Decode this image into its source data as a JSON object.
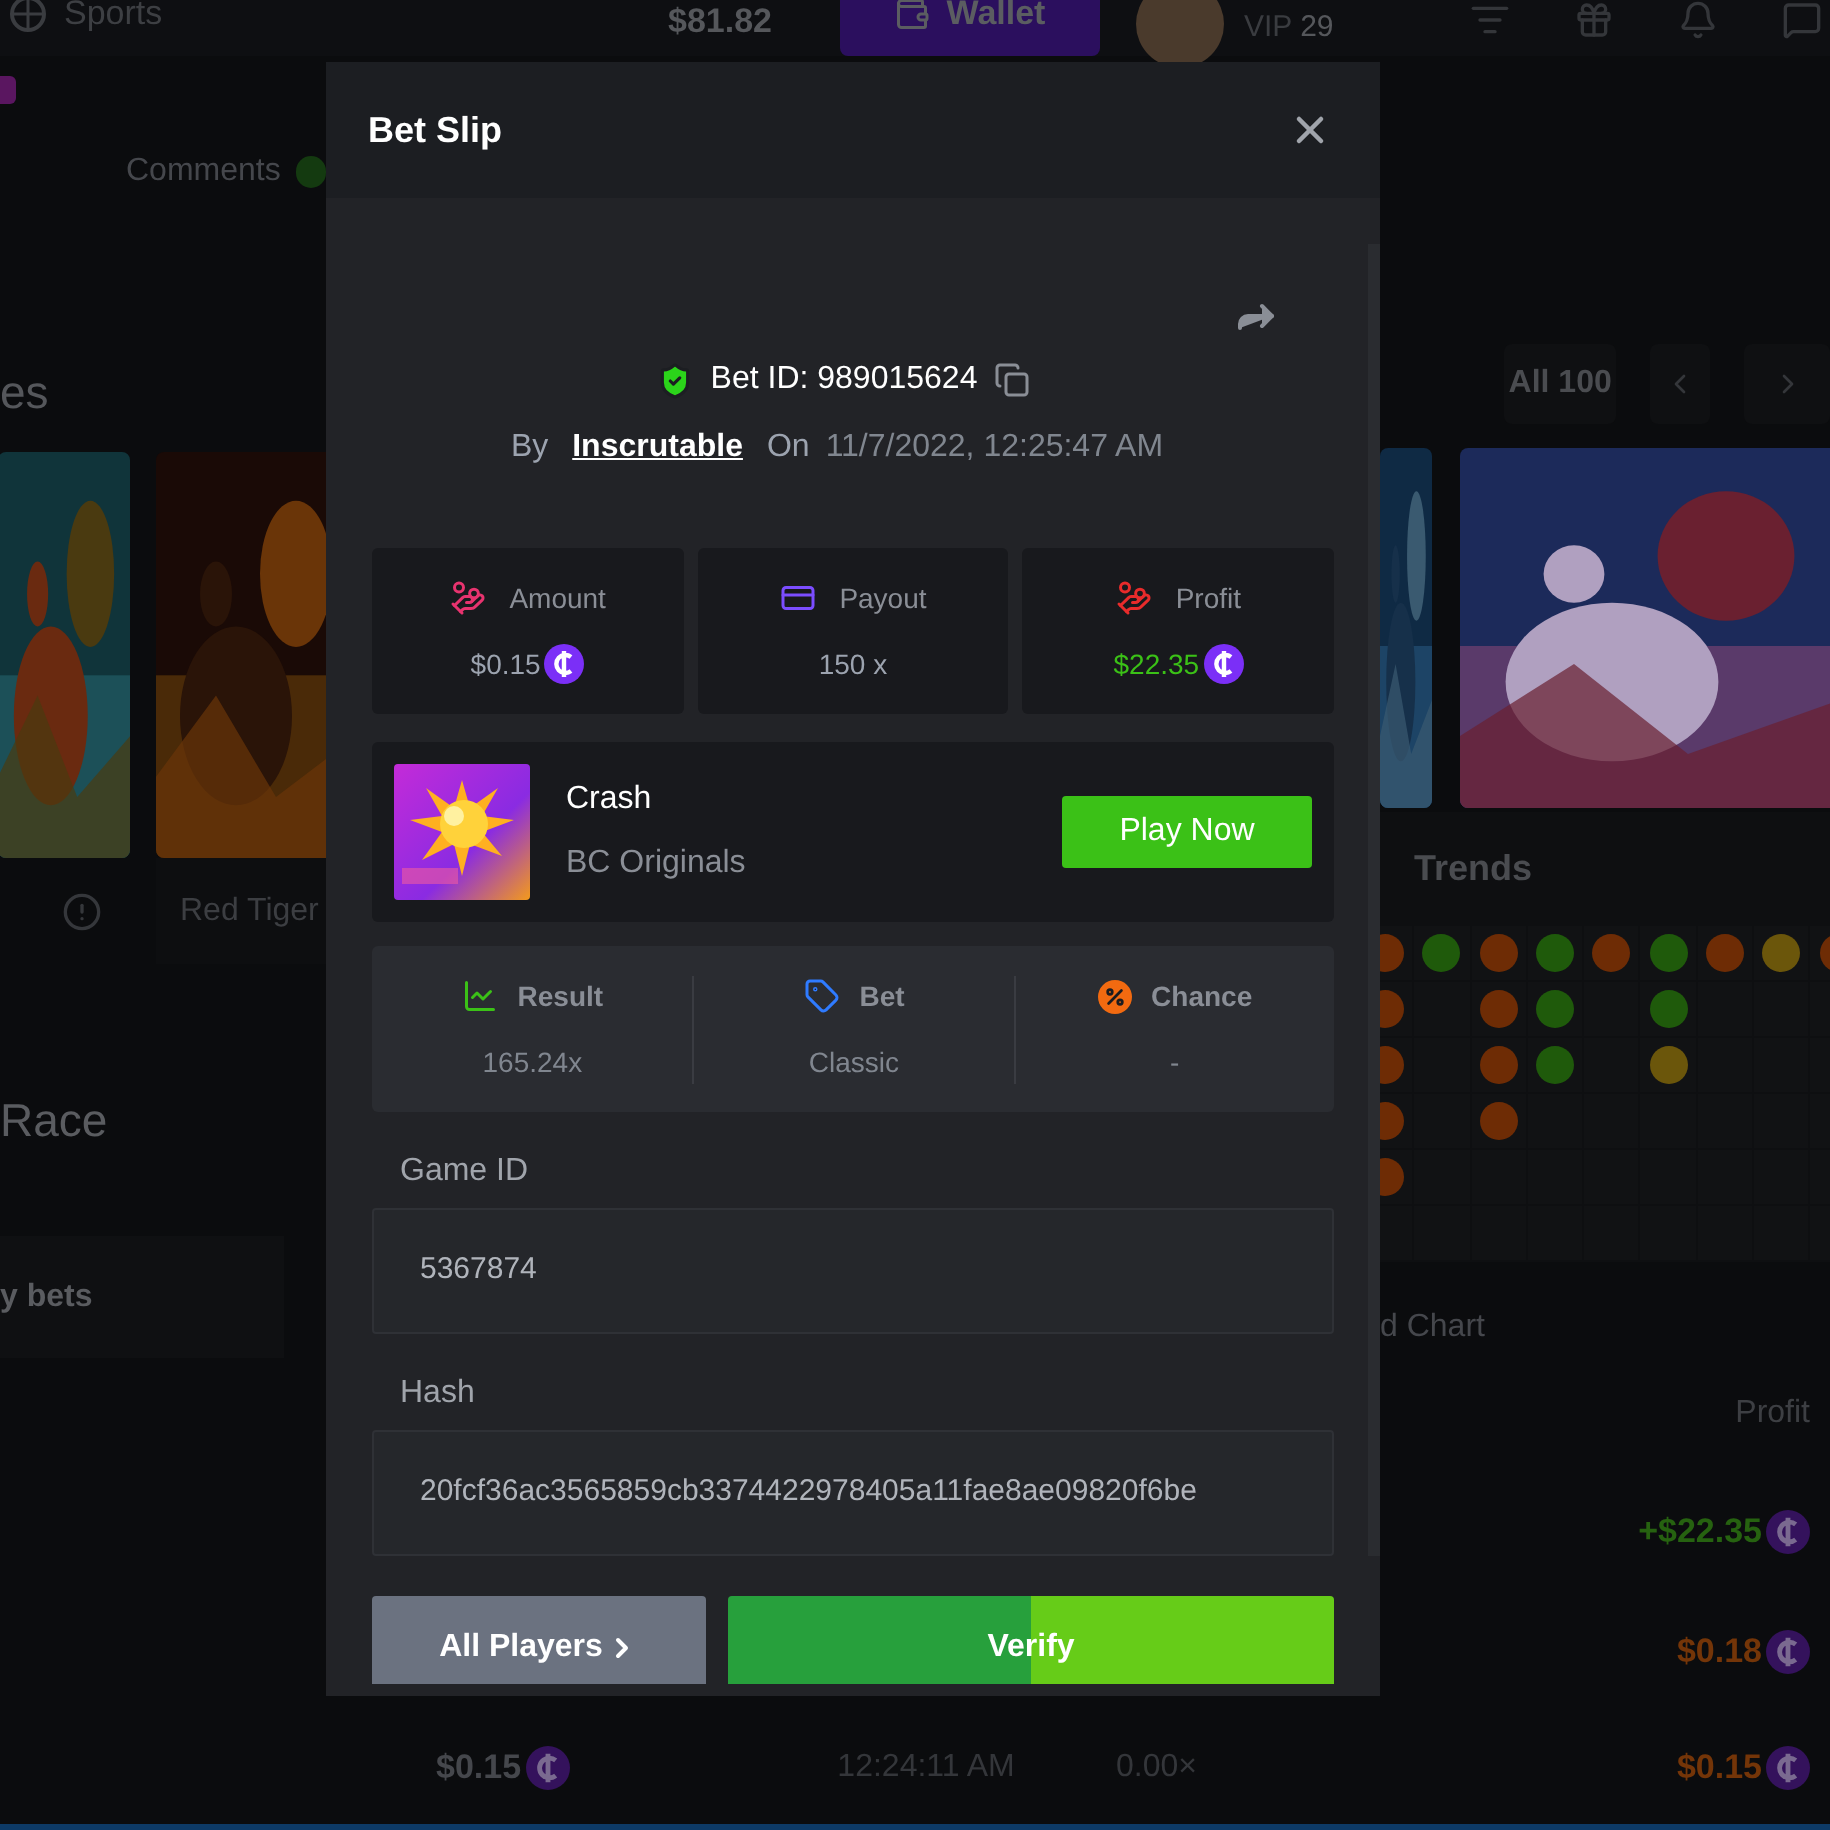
{
  "top_bar": {
    "nav_label": "Sports",
    "balance": "$81.82",
    "wallet_button": "Wallet",
    "vip_label": "VIP",
    "vip_level": "29"
  },
  "comments_tab": "Comments",
  "section_title": "es",
  "all_button": "All 100",
  "provider": "Red Tiger",
  "race_title": "Race",
  "bets_tab": "y bets",
  "trends": {
    "title": "Trends",
    "columns": [
      {
        "dots": [
          {
            "color": "#6e2c05"
          },
          {
            "color": "#6e2c05"
          },
          {
            "color": "#6e2c05"
          },
          {
            "color": "#6e2c05"
          },
          {
            "color": "#6e2c05"
          }
        ]
      },
      {
        "dots": [
          {
            "color": "#1f5a0b"
          }
        ]
      },
      {
        "dots": [
          {
            "color": "#6e2c05"
          },
          {
            "color": "#6e2c05"
          },
          {
            "color": "#6e2c05"
          },
          {
            "color": "#6e2c05"
          }
        ]
      },
      {
        "dots": [
          {
            "color": "#1f5a0b"
          },
          {
            "color": "#1f5a0b"
          },
          {
            "color": "#1f5a0b"
          }
        ]
      },
      {
        "dots": [
          {
            "color": "#6e2c05"
          }
        ]
      },
      {
        "dots": [
          {
            "color": "#1f5a0b"
          },
          {
            "color": "#1f5a0b"
          },
          {
            "color": "#6b560b"
          }
        ]
      },
      {
        "dots": [
          {
            "color": "#6e2c05"
          }
        ]
      },
      {
        "dots": [
          {
            "color": "#6b560b"
          }
        ]
      },
      {
        "dots": [
          {
            "color": "#6e2c05"
          }
        ]
      }
    ]
  },
  "chart_tab": "d Chart",
  "bets_table": {
    "profit_header": "Profit",
    "rows": [
      {
        "kind": "win",
        "profit": "+$22.35"
      },
      {
        "kind": "loss",
        "profit": "$0.18"
      },
      {
        "kind": "loss",
        "bet": "$0.15",
        "time": "12:24:11 AM",
        "payout": "0.00×",
        "profit": "$0.15"
      }
    ]
  },
  "bet_slip": {
    "title": "Bet Slip",
    "bet_id": "Bet ID: 989015624",
    "by_label": "By",
    "player": "Inscrutable",
    "on_label": "On",
    "date": "11/7/2022, 12:25:47 AM",
    "stats": [
      {
        "kind": "amount",
        "label": "Amount",
        "value": "$0.15",
        "coin": true
      },
      {
        "kind": "payout",
        "label": "Payout",
        "value": "150 x",
        "coin": false
      },
      {
        "kind": "profit",
        "label": "Profit",
        "value": "$22.35",
        "coin": true
      }
    ],
    "game": {
      "name": "Crash",
      "provider": "BC Originals",
      "play_button": "Play Now"
    },
    "details": [
      {
        "kind": "result",
        "label": "Result",
        "value": "165.24x"
      },
      {
        "kind": "bet",
        "label": "Bet",
        "value": "Classic"
      },
      {
        "kind": "chance",
        "label": "Chance",
        "value": "-"
      }
    ],
    "fields": [
      {
        "label": "Game ID",
        "value": "5367874"
      },
      {
        "label": "Hash",
        "value": "20fcf36ac3565859cb3374422978405a11fae8ae09820f6be"
      }
    ],
    "players_button": "All Players",
    "verify_button": "Verify"
  }
}
